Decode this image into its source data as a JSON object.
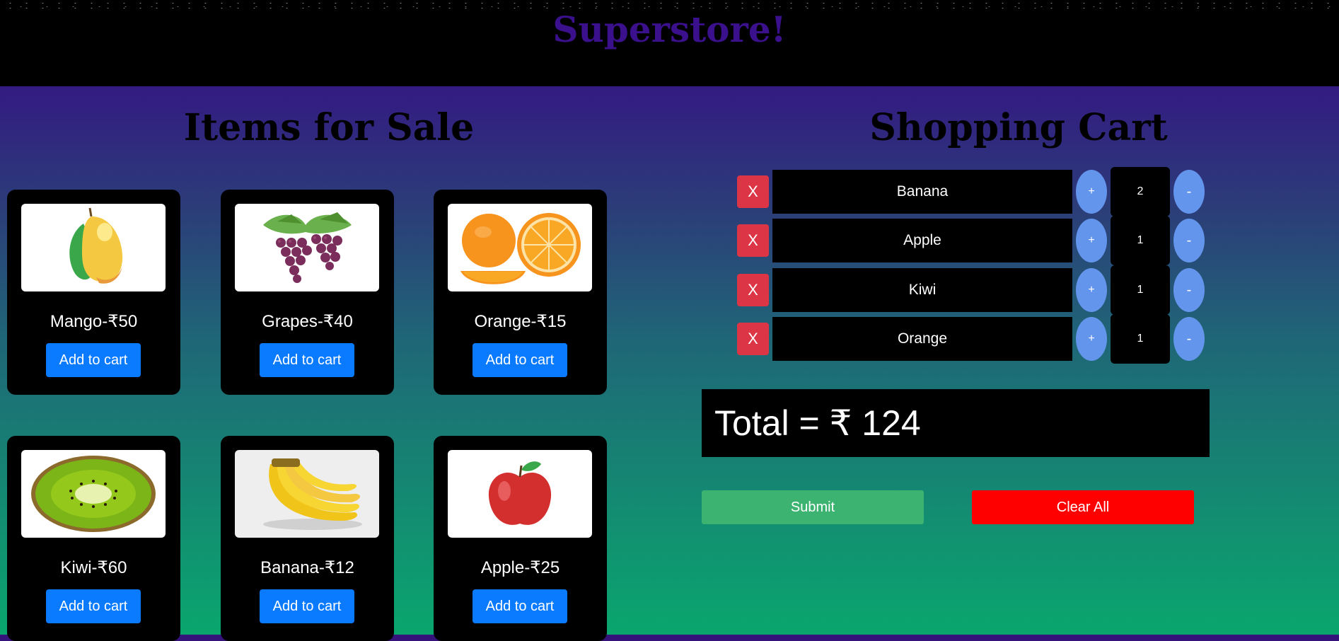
{
  "header": {
    "title": "Superstore!"
  },
  "sale": {
    "title": "Items for Sale",
    "add_label": "Add to cart",
    "items": [
      {
        "name": "Mango-₹50",
        "image": "mango"
      },
      {
        "name": "Grapes-₹40",
        "image": "grapes"
      },
      {
        "name": "Orange-₹15",
        "image": "orange"
      },
      {
        "name": "Kiwi-₹60",
        "image": "kiwi"
      },
      {
        "name": "Banana-₹12",
        "image": "banana"
      },
      {
        "name": "Apple-₹25",
        "image": "apple"
      }
    ]
  },
  "cart": {
    "title": "Shopping Cart",
    "remove_label": "X",
    "plus_label": "+",
    "minus_label": "-",
    "items": [
      {
        "name": "Banana",
        "qty": "2"
      },
      {
        "name": "Apple",
        "qty": "1"
      },
      {
        "name": "Kiwi",
        "qty": "1"
      },
      {
        "name": "Orange",
        "qty": "1"
      }
    ],
    "total": "Total = ₹ 124",
    "submit_label": "Submit",
    "clear_label": "Clear All"
  },
  "colors": {
    "header_bg": "#000000",
    "title": "#3b108c",
    "add_button": "#0a7bff",
    "remove_button": "#dc3545",
    "qty_button": "#6495ed",
    "submit_button": "#3cb371",
    "clear_button": "#ff0000"
  }
}
